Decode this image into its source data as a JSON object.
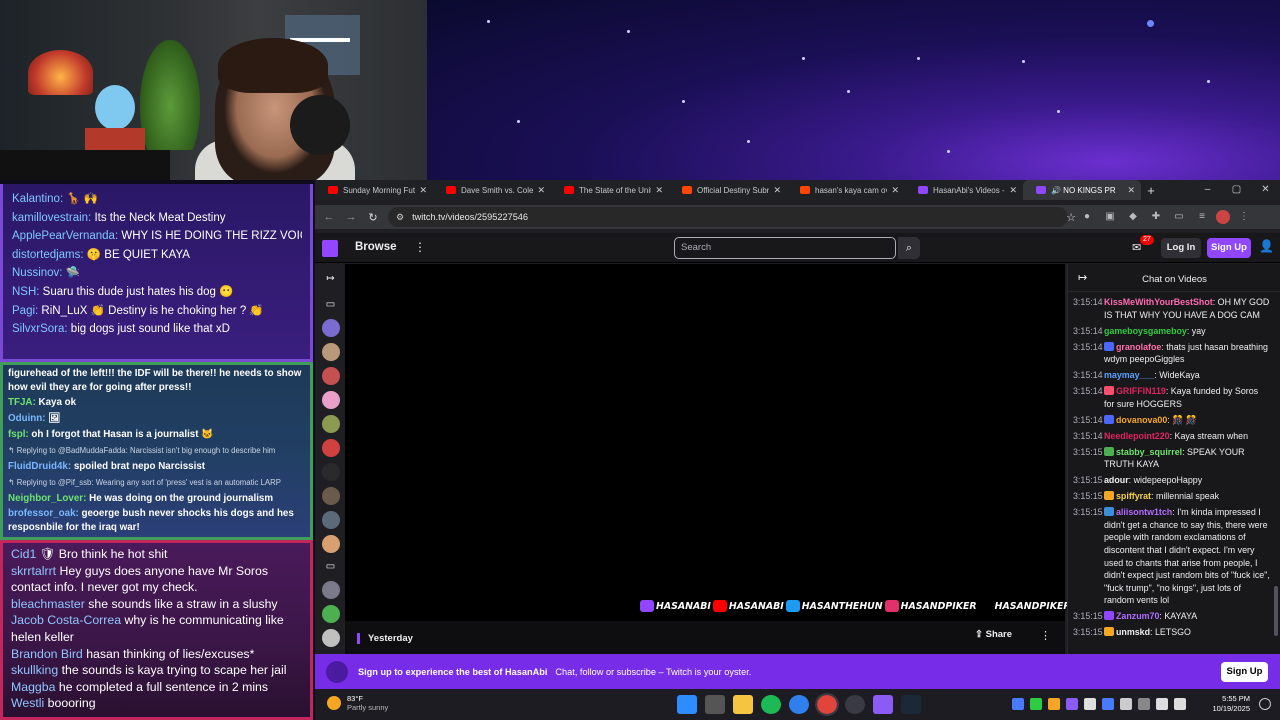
{
  "stream_chat_top": [
    {
      "user": "Kalantino:",
      "text": " 🦒 🙌"
    },
    {
      "user": "kamillovestrain:",
      "text": " Its the Neck Meat Destiny"
    },
    {
      "user": "ApplePearVernanda:",
      "text": " WHY IS HE DOING THE RIZZ VOICE DURING THE DOGS PANTS 😶"
    },
    {
      "user": "distortedjams:",
      "text": " 🤫 BE QUIET KAYA"
    },
    {
      "user": "Nussinov:",
      "text": " 🛸"
    },
    {
      "user": "NSH:",
      "text": " Suaru this dude just hates his dog 😶"
    },
    {
      "user": "Pagi:",
      "text": " RiN_LuX 👏 Destiny is he choking her ? 👏"
    },
    {
      "user": "SilvxrSora:",
      "text": " big dogs just sound like that xD"
    }
  ],
  "stream_chat_mid": [
    {
      "user": "",
      "text": "figurehead of the left!!! the IDF will be there!! he needs to show how evil they are for going after press!!",
      "kind": "wrap"
    },
    {
      "user": "TFJA:",
      "text": " Kaya ok",
      "color": "ug"
    },
    {
      "user": "Oduinn:",
      "text": " 🖼",
      "color": "ub"
    },
    {
      "user": "fspl:",
      "text": " oh I forgot that Hasan is a journalist 🐱",
      "color": "ug"
    },
    {
      "user": "",
      "text": "↰ Replying to @BadMuddaFadda: Narcissist isn't big enough to describe him",
      "kind": "small"
    },
    {
      "user": "FluidDruid4k:",
      "text": " spoiled brat nepo Narcissist",
      "color": "ub"
    },
    {
      "user": "",
      "text": "↰ Replying to @Pif_ssb: Wearing any sort of 'press' vest is an automatic LARP",
      "kind": "small"
    },
    {
      "user": "Neighbor_Lover:",
      "text": " He was doing on the ground journalism",
      "color": "ug"
    },
    {
      "user": "brofessor_oak:",
      "text": " geoerge bush never shocks his dogs and hes resposnbile for the iraq war!",
      "color": "ub",
      "kind": "wrap"
    }
  ],
  "stream_chat_bottom": [
    {
      "user": "Cid1",
      "text": " 🛡 Bro think he hot shit"
    },
    {
      "user": "skrrtalrrt",
      "text": " Hey guys does anyone have Mr Soros contact info. I never got my check."
    },
    {
      "user": "bleachmaster",
      "text": " she sounds like a straw in a slushy"
    },
    {
      "user": "Jacob Costa-Correa",
      "text": " why is he communicating like helen keller"
    },
    {
      "user": "Brandon Bird",
      "text": " hasan thinking of lies/excuses*"
    },
    {
      "user": "skullking",
      "text": " the sounds is kaya trying to scape her jail"
    },
    {
      "user": "Maggba",
      "text": " he completed a full sentence in 2 mins"
    },
    {
      "user": "Westli",
      "text": " boooring"
    }
  ],
  "tabs": [
    {
      "label": "Sunday Morning Futu",
      "fav": "#ff0000"
    },
    {
      "label": "Dave Smith vs. Colem",
      "fav": "#ff0000"
    },
    {
      "label": "The State of the Unite",
      "fav": "#ff0000"
    },
    {
      "label": "Official Destiny Subre",
      "fav": "#ff4500"
    },
    {
      "label": "hasan's kaya cam ove",
      "fav": "#ff4500"
    },
    {
      "label": "HasanAbi's Videos - T",
      "fav": "#9147ff"
    },
    {
      "label": "🔊 NO KINGS PR",
      "fav": "#9147ff",
      "active": true
    }
  ],
  "window_controls": {
    "minimize": "–",
    "maximize": "▢",
    "close": "✕"
  },
  "address": {
    "url": "twitch.tv/videos/2595227546"
  },
  "twitch": {
    "browse": "Browse",
    "search_placeholder": "Search",
    "inbox_count": "27",
    "login": "Log In",
    "signup": "Sign Up",
    "chat_title": "Chat on Videos",
    "yesterday": "Yesterday",
    "share": "Share"
  },
  "overlay_socials": [
    {
      "label": "HASANABI",
      "color": "#9147ff"
    },
    {
      "label": "HASANABI",
      "color": "#ff0000"
    },
    {
      "label": "HASANTHEHUN",
      "color": "#1d9bf0"
    },
    {
      "label": "HASANDPIKER",
      "color": "#e1306c"
    },
    {
      "label": "HASANDPIKER",
      "color": "#000000"
    }
  ],
  "vod_chat": [
    {
      "ts": "3:15:14",
      "name": "KissMeWithYourBestShot",
      "color": "#ff69b4",
      "text": ": OH MY GOD IS THAT WHY YOU HAVE A DOG CAM",
      "badge": ""
    },
    {
      "ts": "3:15:14",
      "name": "gameboysgameboy",
      "color": "#2ecc40",
      "text": ": yay",
      "badge": ""
    },
    {
      "ts": "3:15:14",
      "name": "granolafoe",
      "color": "#ff6fa8",
      "text": ": thats just hasan breathing wdym peepoGiggles",
      "badge": "#4a67ff"
    },
    {
      "ts": "3:15:14",
      "name": "maymay___",
      "color": "#5aa0ff",
      "text": ": WideKaya",
      "badge": ""
    },
    {
      "ts": "3:15:14",
      "name": "GRIFFIN119",
      "color": "#e0245e",
      "text": ": Kaya funded by Soros for sure HOGGERS",
      "badge": "#ff4d6d"
    },
    {
      "ts": "3:15:14",
      "name": "dovanova00",
      "color": "#f5a623",
      "text": ": 🎊 🎊",
      "badge": "#4a67ff"
    },
    {
      "ts": "3:15:14",
      "name": "Needlepoint220",
      "color": "#e0245e",
      "text": ": Kaya stream when",
      "badge": ""
    },
    {
      "ts": "3:15:15",
      "name": "stabby_squirrel",
      "color": "#6ee36e",
      "text": ": SPEAK YOUR TRUTH KAYA",
      "badge": "#4caf50"
    },
    {
      "ts": "3:15:15",
      "name": "adour",
      "color": "#efeff1",
      "text": ": widepeepoHappy",
      "badge": ""
    },
    {
      "ts": "3:15:15",
      "name": "spiffyrat",
      "color": "#f5d04a",
      "text": ": millennial speak",
      "badge": "#f5a623"
    },
    {
      "ts": "3:15:15",
      "name": "aliisontw1tch",
      "color": "#b36bff",
      "text": ": I'm kinda impressed I didn't get a chance to say this, there were people with random exclamations of discontent that I didn't expect. I'm very used to chants that arise from people, I didn't expect just random bits of \"fuck ice\", \"fuck trump\", \"no kings\", just lots of random vents lol",
      "badge": "#3a8fd8"
    },
    {
      "ts": "3:15:15",
      "name": "Zanzum70",
      "color": "#b36bff",
      "text": ": KAYAYA",
      "badge": "#9147ff"
    },
    {
      "ts": "3:15:15",
      "name": "unmskd",
      "color": "#efeff1",
      "text": ": LETSGO",
      "badge": "#f5a623"
    }
  ],
  "banner": {
    "title": "Sign up to experience the best of HasanAbi",
    "subtitle": "Chat, follow or subscribe – Twitch is your oyster.",
    "button": "Sign Up"
  },
  "taskbar": {
    "temp": "83°F",
    "weather": "Partly sunny",
    "time": "5:55 PM",
    "date": "10/19/2025"
  },
  "colors": {
    "twitch_purple": "#9147ff",
    "banner": "#772ce8"
  }
}
